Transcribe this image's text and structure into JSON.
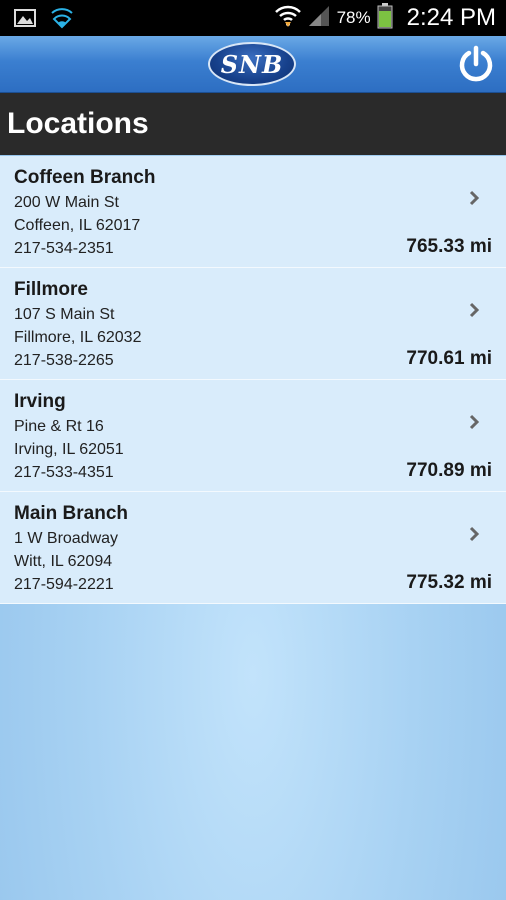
{
  "status_bar": {
    "battery_percent": "78%",
    "time": "2:24 PM",
    "icons": [
      "image-icon",
      "wifi-call-icon",
      "wifi-icon",
      "cell-signal-icon",
      "battery-icon"
    ]
  },
  "header": {
    "logo_text": "SNB",
    "power_icon": "power-icon"
  },
  "page": {
    "title": "Locations"
  },
  "locations": [
    {
      "name": "Coffeen Branch",
      "address1": "200 W Main St",
      "address2": "Coffeen, IL 62017",
      "phone": "217-534-2351",
      "distance": "765.33 mi"
    },
    {
      "name": "Fillmore",
      "address1": "107 S Main St",
      "address2": "Fillmore, IL 62032",
      "phone": "217-538-2265",
      "distance": "770.61 mi"
    },
    {
      "name": "Irving",
      "address1": "Pine & Rt 16",
      "address2": "Irving, IL 62051",
      "phone": "217-533-4351",
      "distance": "770.89 mi"
    },
    {
      "name": "Main Branch",
      "address1": "1 W Broadway",
      "address2": "Witt, IL 62094",
      "phone": "217-594-2221",
      "distance": "775.32 mi"
    }
  ],
  "colors": {
    "status_bar_bg": "#000000",
    "header_blue": "#3b7fd0",
    "title_bar_bg": "#2a2a2a",
    "list_item_bg": "#d9ecfb",
    "page_bg": "#a8d2f3"
  }
}
